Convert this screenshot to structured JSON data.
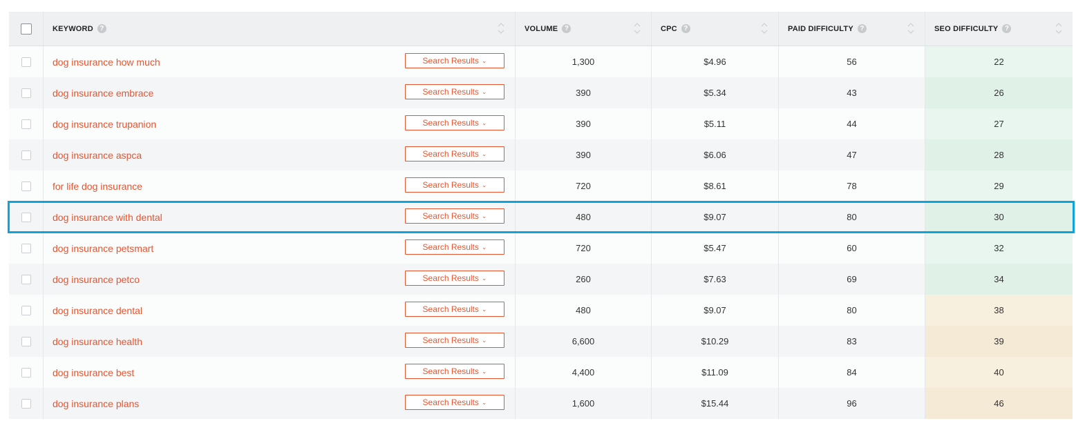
{
  "header": {
    "keyword": "KEYWORD",
    "volume": "VOLUME",
    "cpc": "CPC",
    "paid": "PAID DIFFICULTY",
    "seo": "SEO DIFFICULTY",
    "help_glyph": "?"
  },
  "button_label": "Search Results",
  "button_chevron": "⌄",
  "highlighted_row": 5,
  "colors": {
    "accent": "#e8542f",
    "highlight": "#0fa3de",
    "seo_easy": "#e8f6ef",
    "seo_medium": "#f8f0de"
  },
  "rows": [
    {
      "keyword": "dog insurance how much",
      "volume": "1,300",
      "cpc": "$4.96",
      "paid": "56",
      "seo": "22",
      "level": "green"
    },
    {
      "keyword": "dog insurance embrace",
      "volume": "390",
      "cpc": "$5.34",
      "paid": "43",
      "seo": "26",
      "level": "green"
    },
    {
      "keyword": "dog insurance trupanion",
      "volume": "390",
      "cpc": "$5.11",
      "paid": "44",
      "seo": "27",
      "level": "green"
    },
    {
      "keyword": "dog insurance aspca",
      "volume": "390",
      "cpc": "$6.06",
      "paid": "47",
      "seo": "28",
      "level": "green"
    },
    {
      "keyword": "for life dog insurance",
      "volume": "720",
      "cpc": "$8.61",
      "paid": "78",
      "seo": "29",
      "level": "green"
    },
    {
      "keyword": "dog insurance with dental",
      "volume": "480",
      "cpc": "$9.07",
      "paid": "80",
      "seo": "30",
      "level": "green"
    },
    {
      "keyword": "dog insurance petsmart",
      "volume": "720",
      "cpc": "$5.47",
      "paid": "60",
      "seo": "32",
      "level": "green"
    },
    {
      "keyword": "dog insurance petco",
      "volume": "260",
      "cpc": "$7.63",
      "paid": "69",
      "seo": "34",
      "level": "green"
    },
    {
      "keyword": "dog insurance dental",
      "volume": "480",
      "cpc": "$9.07",
      "paid": "80",
      "seo": "38",
      "level": "beige"
    },
    {
      "keyword": "dog insurance health",
      "volume": "6,600",
      "cpc": "$10.29",
      "paid": "83",
      "seo": "39",
      "level": "beige"
    },
    {
      "keyword": "dog insurance best",
      "volume": "4,400",
      "cpc": "$11.09",
      "paid": "84",
      "seo": "40",
      "level": "beige"
    },
    {
      "keyword": "dog insurance plans",
      "volume": "1,600",
      "cpc": "$15.44",
      "paid": "96",
      "seo": "46",
      "level": "beige"
    }
  ]
}
